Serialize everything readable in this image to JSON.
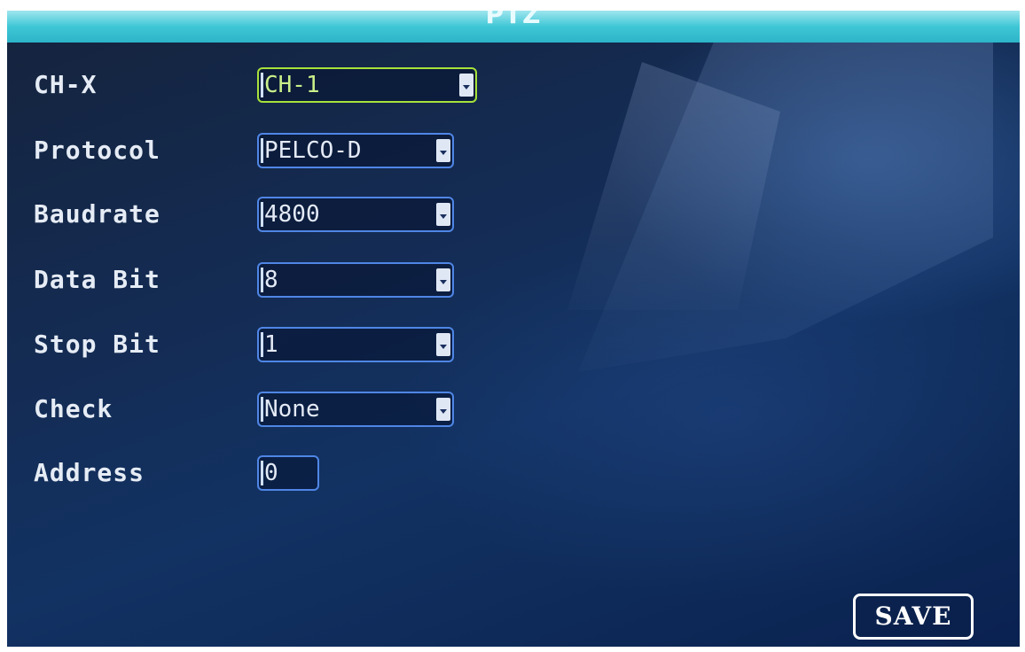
{
  "title": "PTZ",
  "fields": [
    {
      "label": "CH-X",
      "value": "CH-1",
      "type": "dropdown",
      "focused": true
    },
    {
      "label": "Protocol",
      "value": "PELCO-D",
      "type": "dropdown",
      "focused": false
    },
    {
      "label": "Baudrate",
      "value": "4800",
      "type": "dropdown",
      "focused": false
    },
    {
      "label": "Data Bit",
      "value": "8",
      "type": "dropdown",
      "focused": false
    },
    {
      "label": "Stop Bit",
      "value": "1",
      "type": "dropdown",
      "focused": false
    },
    {
      "label": "Check",
      "value": "None",
      "type": "dropdown",
      "focused": false
    },
    {
      "label": "Address",
      "value": "0",
      "type": "text",
      "focused": false
    }
  ],
  "save_label": "SAVE",
  "colors": {
    "title_bar": "#3fc7d6",
    "field_border": "#4f86e6",
    "focus_border": "#a7e23a",
    "text": "#e6ecf5"
  }
}
